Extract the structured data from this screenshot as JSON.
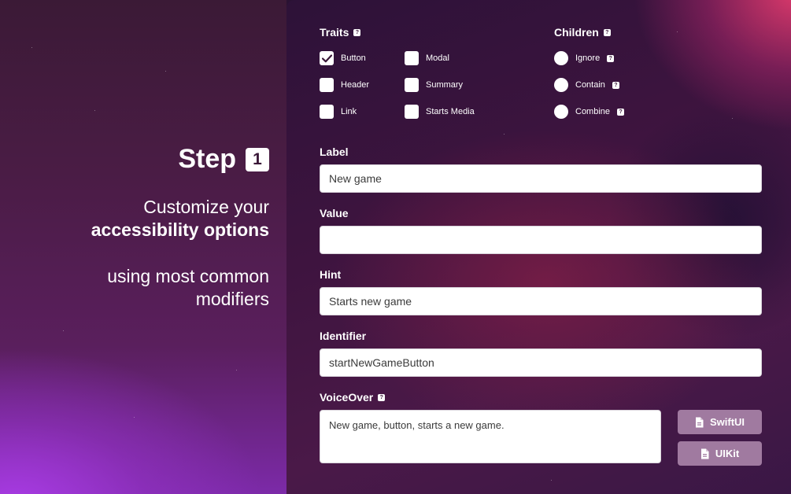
{
  "left": {
    "step_label": "Step",
    "step_number": "1",
    "subtitle_line1": "Customize your",
    "subtitle_line2": "accessibility options",
    "subtitle2": "using most common modifiers"
  },
  "traits": {
    "title": "Traits",
    "help": "?",
    "options": [
      {
        "label": "Button",
        "checked": true
      },
      {
        "label": "Modal",
        "checked": false
      },
      {
        "label": "Header",
        "checked": false
      },
      {
        "label": "Summary",
        "checked": false
      },
      {
        "label": "Link",
        "checked": false
      },
      {
        "label": "Starts Media",
        "checked": false
      }
    ]
  },
  "children": {
    "title": "Children",
    "help": "?",
    "options": [
      {
        "label": "Ignore",
        "help": "?"
      },
      {
        "label": "Contain",
        "help": "?"
      },
      {
        "label": "Combine",
        "help": "?"
      }
    ]
  },
  "fields": {
    "label": {
      "title": "Label",
      "value": "New game"
    },
    "value": {
      "title": "Value",
      "value": ""
    },
    "hint": {
      "title": "Hint",
      "value": "Starts new game"
    },
    "identifier": {
      "title": "Identifier",
      "value": "startNewGameButton"
    }
  },
  "voiceover": {
    "title": "VoiceOver",
    "help": "?",
    "text": "New game, button, starts a new game."
  },
  "buttons": {
    "swiftui": "SwiftUI",
    "uikit": "UIKit",
    "icon": "document-icon",
    "color": "#a07aa0"
  }
}
